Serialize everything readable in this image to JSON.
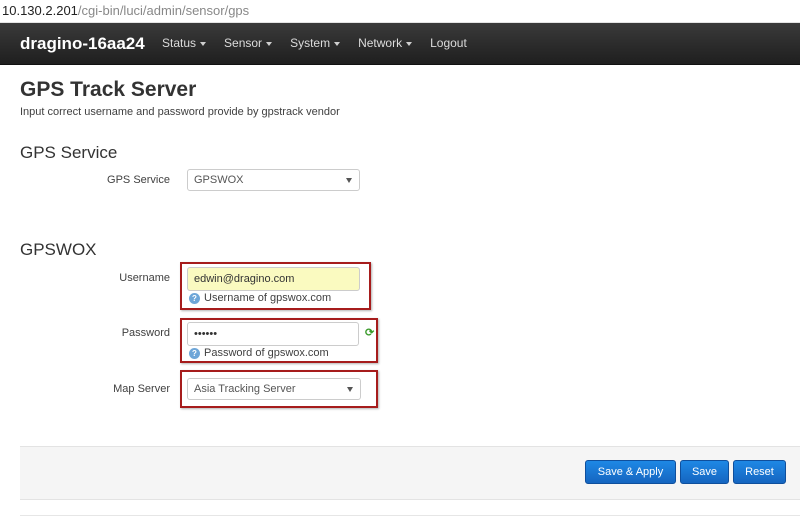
{
  "browser": {
    "url_host": "10.130.2.201",
    "url_path": "/cgi-bin/luci/admin/sensor/gps"
  },
  "navbar": {
    "brand": "dragino-16aa24",
    "items": [
      {
        "label": "Status",
        "has_caret": true
      },
      {
        "label": "Sensor",
        "has_caret": true
      },
      {
        "label": "System",
        "has_caret": true
      },
      {
        "label": "Network",
        "has_caret": true
      },
      {
        "label": "Logout",
        "has_caret": false
      }
    ]
  },
  "page": {
    "title": "GPS Track Server",
    "description": "Input correct username and password provide by gpstrack vendor"
  },
  "gps_service_section": {
    "heading": "GPS Service",
    "field_label": "GPS Service",
    "selected": "GPSWOX"
  },
  "gpswox_section": {
    "heading": "GPSWOX",
    "username": {
      "label": "Username",
      "value": "edwin@dragino.com",
      "hint": "Username of gpswox.com"
    },
    "password": {
      "label": "Password",
      "value": "••••••",
      "hint": "Password of gpswox.com"
    },
    "map_server": {
      "label": "Map Server",
      "selected": "Asia Tracking Server"
    }
  },
  "actions": {
    "save_apply": "Save & Apply",
    "save": "Save",
    "reset": "Reset"
  },
  "colors": {
    "navbar": "#2a2a2a",
    "button": "#1976d2",
    "highlight": "#a61c1c",
    "autofill": "#fafac0"
  },
  "icons": {
    "hint": "help-icon",
    "reveal": "refresh-icon"
  }
}
